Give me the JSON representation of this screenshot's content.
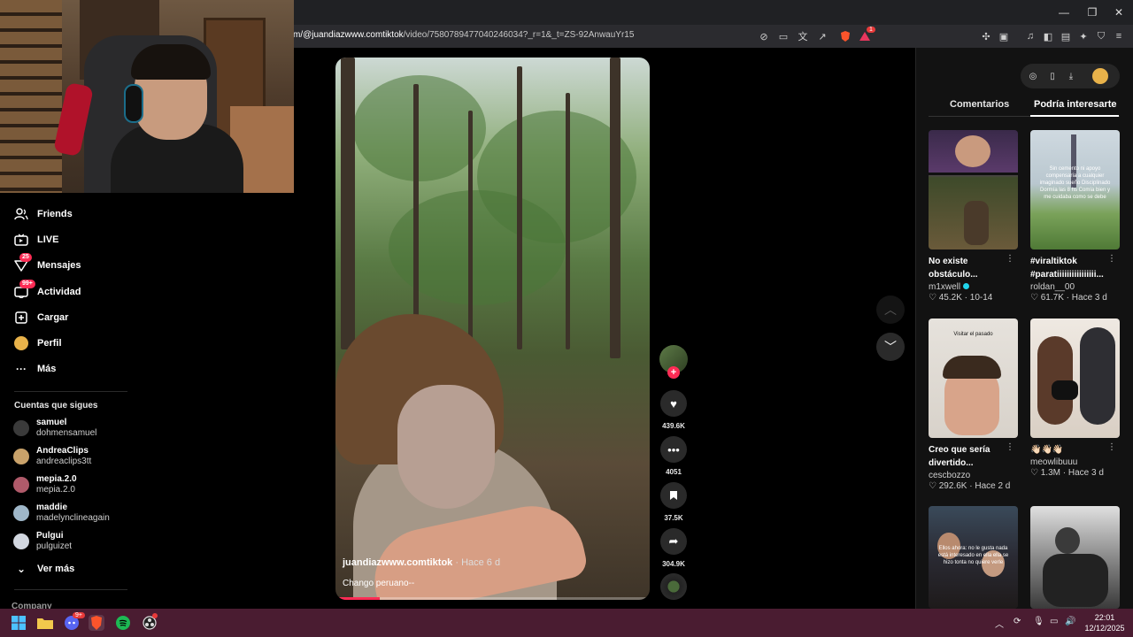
{
  "browser": {
    "url_prefix": "m/@juandiazwww.comtiktok",
    "url_rest": "/video/7580789477040246034?_r=1&_t=ZS-92AnwauYr15",
    "window_controls": [
      "minimize",
      "restore",
      "close"
    ],
    "extension_badge": "1"
  },
  "sidebar": {
    "items": [
      {
        "label": "Friends",
        "icon": "friends-icon"
      },
      {
        "label": "LIVE",
        "icon": "live-icon"
      },
      {
        "label": "Mensajes",
        "icon": "messages-icon",
        "badge": "25"
      },
      {
        "label": "Actividad",
        "icon": "activity-icon",
        "badge": "99+"
      },
      {
        "label": "Cargar",
        "icon": "upload-icon"
      },
      {
        "label": "Perfil",
        "icon": "profile-icon"
      },
      {
        "label": "Más",
        "icon": "more-icon"
      }
    ],
    "following_title": "Cuentas que sigues",
    "following": [
      {
        "name": "samuel",
        "handle": "dohmensamuel",
        "color": "#3a3a3a"
      },
      {
        "name": "AndreaClips",
        "handle": "andreaclips3tt",
        "color": "#c9a26a"
      },
      {
        "name": "mepia.2.0",
        "handle": "mepia.2.0",
        "color": "#b05a6a"
      },
      {
        "name": "maddie",
        "handle": "madelynclineagain",
        "color": "#9fb7c9"
      },
      {
        "name": "Pulgui",
        "handle": "pulguizet",
        "color": "#d2d7e0"
      }
    ],
    "see_more": "Ver más",
    "company": "Company"
  },
  "video": {
    "author": "juandiazwww.comtiktok",
    "time": "· Hace 6 d",
    "caption": "Chango peruano--",
    "progress": 0.14
  },
  "actions": {
    "likes": "439.6K",
    "comments": "4051",
    "saves": "37.5K",
    "shares": "304.9K"
  },
  "right_panel": {
    "tabs": [
      "Comentarios",
      "Podría interesarte"
    ],
    "active_tab": 1,
    "cards": [
      {
        "title": "No existe obstáculo...",
        "user": "m1xwell",
        "verified": true,
        "likes": "45.2K",
        "date": "10-14",
        "thumb": "stream"
      },
      {
        "title": "#viraltiktok #paratiiiiiiiiiiiiiiii...",
        "user": "roldan__00",
        "verified": false,
        "likes": "61.7K",
        "date": "Hace 3 d",
        "thumb": "field",
        "thumb_text": "Sin cemento ni apoyo compensaría a cualquier imaginado sueño Disciplinado Dormía las 8 hs Comía bien y me cuidaba como se debe"
      },
      {
        "title": "Creo que sería divertido...",
        "user": "cescbozzo",
        "verified": false,
        "likes": "292.6K",
        "date": "Hace 2 d",
        "thumb": "man",
        "thumb_text": "Visitar el pasado"
      },
      {
        "title": "👋🏻👋🏻👋🏻",
        "user": "meowlibuuu",
        "verified": false,
        "likes": "1.3M",
        "date": "Hace 3 d",
        "thumb": "couple"
      },
      {
        "title": "",
        "user": "",
        "verified": false,
        "likes": "",
        "date": "",
        "thumb": "crowd",
        "thumb_text": "Ellos ahora: no le gusta nada está interesado en ella ella se hizo tonta no quiere verle"
      },
      {
        "title": "",
        "user": "",
        "verified": false,
        "likes": "",
        "date": "",
        "thumb": "cat"
      }
    ]
  },
  "taskbar": {
    "time": "22:01",
    "date": "12/12/2025",
    "discord_badge": "9+",
    "apps": [
      "windows-icon",
      "folder-icon",
      "brave-icon",
      "discord-icon",
      "spotify-icon",
      "obs-icon"
    ]
  },
  "colors": {
    "accent": "#fe2c55",
    "taskbar": "#4a1c31",
    "chrome": "#202124",
    "panel": "#121212"
  }
}
